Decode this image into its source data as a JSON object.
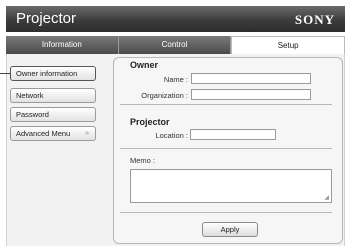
{
  "header": {
    "title": "Projector",
    "brand": "SONY"
  },
  "tabs": [
    {
      "label": "Information"
    },
    {
      "label": "Control"
    },
    {
      "label": "Setup"
    }
  ],
  "sidebar": {
    "items": [
      {
        "label": "Owner information"
      },
      {
        "label": "Network"
      },
      {
        "label": "Password"
      },
      {
        "label": "Advanced Menu"
      }
    ],
    "expand_glyph": "»"
  },
  "owner": {
    "section_title": "Owner",
    "name_label": "Name :",
    "name_value": "",
    "organization_label": "Organization :",
    "organization_value": ""
  },
  "projector": {
    "section_title": "Projector",
    "location_label": "Location :",
    "location_value": ""
  },
  "memo": {
    "label": "Memo :",
    "value": ""
  },
  "apply_label": "Apply"
}
